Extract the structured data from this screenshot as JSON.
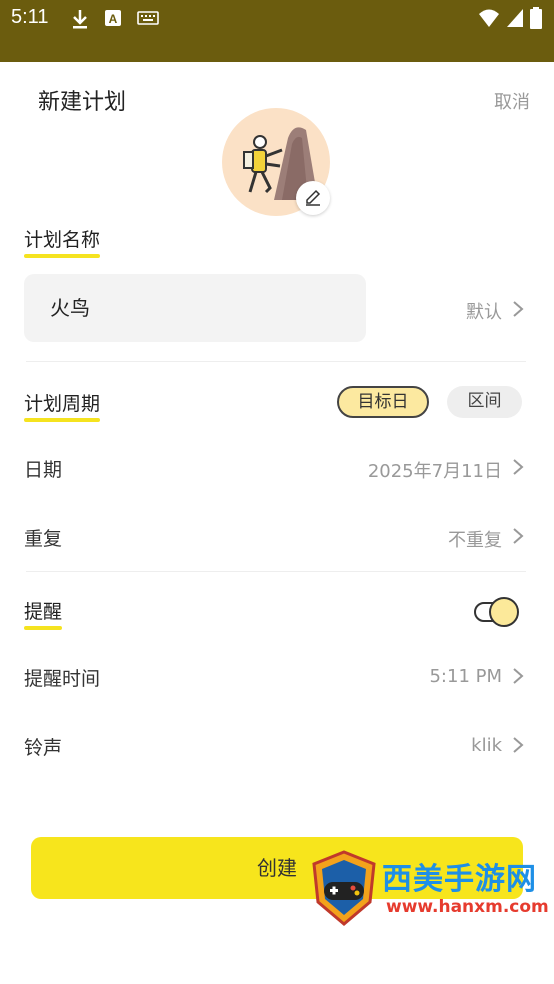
{
  "status_bar": {
    "time": "5:11",
    "icons": [
      "download-icon",
      "a-box-icon",
      "keyboard-icon"
    ],
    "right_icons": [
      "wifi-icon",
      "signal-icon",
      "battery-icon"
    ],
    "bg_color": "#6b5c0e"
  },
  "sheet": {
    "title": "新建计划",
    "cancel_label": "取消"
  },
  "avatar": {
    "icon": "climber-icon",
    "edit_icon": "pencil-icon"
  },
  "plan_name": {
    "label": "计划名称",
    "value": "火鸟",
    "default_label": "默认"
  },
  "plan_period": {
    "label": "计划周期",
    "options": [
      "目标日",
      "区间"
    ],
    "selected": "目标日"
  },
  "date_row": {
    "label": "日期",
    "value": "2025年7月11日"
  },
  "repeat_row": {
    "label": "重复",
    "value": "不重复"
  },
  "reminder": {
    "label": "提醒",
    "enabled": true
  },
  "reminder_time_row": {
    "label": "提醒时间",
    "value": "5:11 PM"
  },
  "ringtone_row": {
    "label": "铃声",
    "value": "klik"
  },
  "create_button": {
    "label": "创建"
  },
  "watermark": {
    "text": "西美手游网",
    "url": "www.hanxm.com"
  },
  "colors": {
    "accent": "#f7e51c",
    "pill_active": "#fce9a0"
  }
}
